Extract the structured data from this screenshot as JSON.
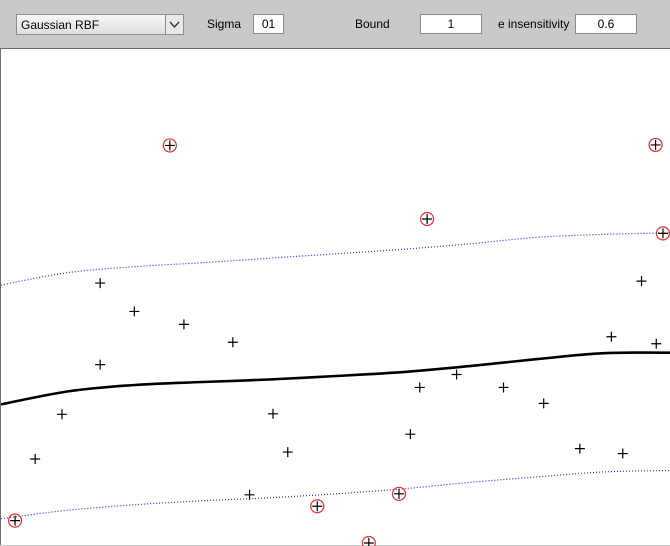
{
  "toolbar": {
    "kernel": {
      "selected": "Gaussian RBF",
      "icon": "chevron-down-icon"
    },
    "sigma": {
      "label": "Sigma",
      "value": "01"
    },
    "bound": {
      "label": "Bound",
      "value": "1"
    },
    "epsilon": {
      "label": "e insensitivity",
      "value": "0.6"
    }
  },
  "colors": {
    "support_vector_circle": "#e03030",
    "margin_line": "#1f2fd0",
    "regression_curve": "#000000",
    "panel_background": "#c9c9c9"
  },
  "chart_data": {
    "type": "scatter",
    "xlim": [
      0,
      1
    ],
    "ylim": [
      0,
      1
    ],
    "grid": false,
    "series": [
      {
        "role": "data-points",
        "x": [
          0.148,
          0.199,
          0.273,
          0.346,
          0.148,
          0.091,
          0.051,
          0.406,
          0.428,
          0.371,
          0.625,
          0.68,
          0.75,
          0.611,
          0.81,
          0.864,
          0.911,
          0.956,
          0.928,
          0.978
        ],
        "y": [
          0.529,
          0.472,
          0.446,
          0.41,
          0.365,
          0.265,
          0.175,
          0.266,
          0.189,
          0.103,
          0.319,
          0.345,
          0.319,
          0.225,
          0.287,
          0.196,
          0.421,
          0.533,
          0.186,
          0.407
        ]
      },
      {
        "role": "support-vectors",
        "x": [
          0.252,
          0.636,
          0.977,
          0.988,
          0.021,
          0.472,
          0.594,
          0.549
        ],
        "y": [
          0.806,
          0.658,
          0.807,
          0.629,
          0.051,
          0.08,
          0.105,
          0.006
        ]
      }
    ],
    "curves": {
      "regression": {
        "x": [
          0.0,
          0.1,
          0.2,
          0.3,
          0.4,
          0.5,
          0.6,
          0.7,
          0.8,
          0.9,
          1.0
        ],
        "y": [
          0.285,
          0.311,
          0.324,
          0.33,
          0.335,
          0.342,
          0.35,
          0.362,
          0.376,
          0.388,
          0.389
        ]
      },
      "upper_margin": {
        "x": [
          0.0,
          0.1,
          0.2,
          0.3,
          0.4,
          0.5,
          0.6,
          0.7,
          0.8,
          0.9,
          1.0
        ],
        "y": [
          0.525,
          0.55,
          0.562,
          0.57,
          0.579,
          0.588,
          0.597,
          0.608,
          0.621,
          0.627,
          0.63
        ]
      },
      "lower_margin": {
        "x": [
          0.0,
          0.1,
          0.2,
          0.3,
          0.4,
          0.5,
          0.6,
          0.7,
          0.8,
          0.9,
          1.0
        ],
        "y": [
          0.055,
          0.072,
          0.083,
          0.091,
          0.097,
          0.105,
          0.115,
          0.128,
          0.139,
          0.149,
          0.152
        ]
      }
    }
  }
}
